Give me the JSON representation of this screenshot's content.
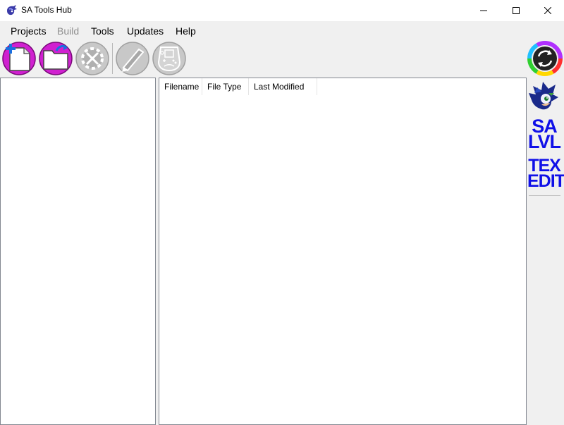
{
  "window": {
    "title": "SA Tools Hub",
    "controls": {
      "minimize": "minimize-icon",
      "maximize": "maximize-icon",
      "close": "close-icon"
    }
  },
  "menu": [
    {
      "label": "Projects",
      "enabled": true
    },
    {
      "label": "Build",
      "enabled": false
    },
    {
      "label": "Tools",
      "enabled": true
    },
    {
      "label": "Updates",
      "enabled": true
    },
    {
      "label": "Help",
      "enabled": true
    }
  ],
  "toolbar": [
    {
      "icon": "new-project-icon",
      "enabled": true
    },
    {
      "icon": "open-project-icon",
      "enabled": true
    },
    {
      "icon": "project-settings-icon",
      "enabled": false
    },
    {
      "icon": "edit-tool-icon",
      "enabled": false
    },
    {
      "icon": "game-controller-icon",
      "enabled": false
    }
  ],
  "file_list": {
    "columns": [
      "Filename",
      "File Type",
      "Last Modified"
    ],
    "rows": []
  },
  "side_tools": [
    {
      "icon": "update-refresh-icon"
    },
    {
      "icon": "sonic-character-icon"
    },
    {
      "label_lines": [
        "SA",
        "LVL"
      ]
    },
    {
      "label_lines": [
        "TEX",
        "EDIT"
      ]
    }
  ],
  "colors": {
    "accent": "#d020d0",
    "brand_blue": "#1010e8",
    "window_bg": "#f0f0f0"
  }
}
